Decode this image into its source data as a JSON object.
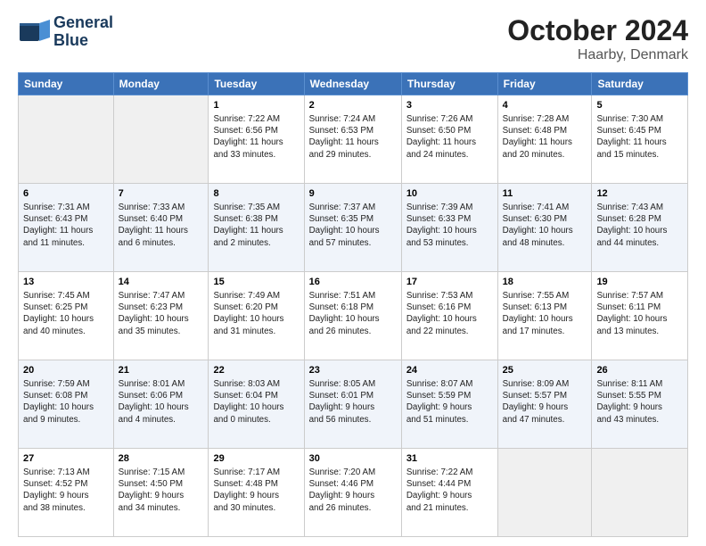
{
  "header": {
    "logo_line1": "General",
    "logo_line2": "Blue",
    "month_title": "October 2024",
    "location": "Haarby, Denmark"
  },
  "weekdays": [
    "Sunday",
    "Monday",
    "Tuesday",
    "Wednesday",
    "Thursday",
    "Friday",
    "Saturday"
  ],
  "weeks": [
    [
      {
        "day": "",
        "info": ""
      },
      {
        "day": "",
        "info": ""
      },
      {
        "day": "1",
        "info": "Sunrise: 7:22 AM\nSunset: 6:56 PM\nDaylight: 11 hours\nand 33 minutes."
      },
      {
        "day": "2",
        "info": "Sunrise: 7:24 AM\nSunset: 6:53 PM\nDaylight: 11 hours\nand 29 minutes."
      },
      {
        "day": "3",
        "info": "Sunrise: 7:26 AM\nSunset: 6:50 PM\nDaylight: 11 hours\nand 24 minutes."
      },
      {
        "day": "4",
        "info": "Sunrise: 7:28 AM\nSunset: 6:48 PM\nDaylight: 11 hours\nand 20 minutes."
      },
      {
        "day": "5",
        "info": "Sunrise: 7:30 AM\nSunset: 6:45 PM\nDaylight: 11 hours\nand 15 minutes."
      }
    ],
    [
      {
        "day": "6",
        "info": "Sunrise: 7:31 AM\nSunset: 6:43 PM\nDaylight: 11 hours\nand 11 minutes."
      },
      {
        "day": "7",
        "info": "Sunrise: 7:33 AM\nSunset: 6:40 PM\nDaylight: 11 hours\nand 6 minutes."
      },
      {
        "day": "8",
        "info": "Sunrise: 7:35 AM\nSunset: 6:38 PM\nDaylight: 11 hours\nand 2 minutes."
      },
      {
        "day": "9",
        "info": "Sunrise: 7:37 AM\nSunset: 6:35 PM\nDaylight: 10 hours\nand 57 minutes."
      },
      {
        "day": "10",
        "info": "Sunrise: 7:39 AM\nSunset: 6:33 PM\nDaylight: 10 hours\nand 53 minutes."
      },
      {
        "day": "11",
        "info": "Sunrise: 7:41 AM\nSunset: 6:30 PM\nDaylight: 10 hours\nand 48 minutes."
      },
      {
        "day": "12",
        "info": "Sunrise: 7:43 AM\nSunset: 6:28 PM\nDaylight: 10 hours\nand 44 minutes."
      }
    ],
    [
      {
        "day": "13",
        "info": "Sunrise: 7:45 AM\nSunset: 6:25 PM\nDaylight: 10 hours\nand 40 minutes."
      },
      {
        "day": "14",
        "info": "Sunrise: 7:47 AM\nSunset: 6:23 PM\nDaylight: 10 hours\nand 35 minutes."
      },
      {
        "day": "15",
        "info": "Sunrise: 7:49 AM\nSunset: 6:20 PM\nDaylight: 10 hours\nand 31 minutes."
      },
      {
        "day": "16",
        "info": "Sunrise: 7:51 AM\nSunset: 6:18 PM\nDaylight: 10 hours\nand 26 minutes."
      },
      {
        "day": "17",
        "info": "Sunrise: 7:53 AM\nSunset: 6:16 PM\nDaylight: 10 hours\nand 22 minutes."
      },
      {
        "day": "18",
        "info": "Sunrise: 7:55 AM\nSunset: 6:13 PM\nDaylight: 10 hours\nand 17 minutes."
      },
      {
        "day": "19",
        "info": "Sunrise: 7:57 AM\nSunset: 6:11 PM\nDaylight: 10 hours\nand 13 minutes."
      }
    ],
    [
      {
        "day": "20",
        "info": "Sunrise: 7:59 AM\nSunset: 6:08 PM\nDaylight: 10 hours\nand 9 minutes."
      },
      {
        "day": "21",
        "info": "Sunrise: 8:01 AM\nSunset: 6:06 PM\nDaylight: 10 hours\nand 4 minutes."
      },
      {
        "day": "22",
        "info": "Sunrise: 8:03 AM\nSunset: 6:04 PM\nDaylight: 10 hours\nand 0 minutes."
      },
      {
        "day": "23",
        "info": "Sunrise: 8:05 AM\nSunset: 6:01 PM\nDaylight: 9 hours\nand 56 minutes."
      },
      {
        "day": "24",
        "info": "Sunrise: 8:07 AM\nSunset: 5:59 PM\nDaylight: 9 hours\nand 51 minutes."
      },
      {
        "day": "25",
        "info": "Sunrise: 8:09 AM\nSunset: 5:57 PM\nDaylight: 9 hours\nand 47 minutes."
      },
      {
        "day": "26",
        "info": "Sunrise: 8:11 AM\nSunset: 5:55 PM\nDaylight: 9 hours\nand 43 minutes."
      }
    ],
    [
      {
        "day": "27",
        "info": "Sunrise: 7:13 AM\nSunset: 4:52 PM\nDaylight: 9 hours\nand 38 minutes."
      },
      {
        "day": "28",
        "info": "Sunrise: 7:15 AM\nSunset: 4:50 PM\nDaylight: 9 hours\nand 34 minutes."
      },
      {
        "day": "29",
        "info": "Sunrise: 7:17 AM\nSunset: 4:48 PM\nDaylight: 9 hours\nand 30 minutes."
      },
      {
        "day": "30",
        "info": "Sunrise: 7:20 AM\nSunset: 4:46 PM\nDaylight: 9 hours\nand 26 minutes."
      },
      {
        "day": "31",
        "info": "Sunrise: 7:22 AM\nSunset: 4:44 PM\nDaylight: 9 hours\nand 21 minutes."
      },
      {
        "day": "",
        "info": ""
      },
      {
        "day": "",
        "info": ""
      }
    ]
  ]
}
